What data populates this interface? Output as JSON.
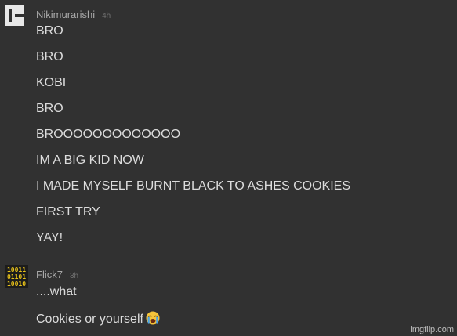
{
  "comments": [
    {
      "username": "Nikimurarishi",
      "time": "4h",
      "avatar_icon": "imgflip-e-logo-icon",
      "lines": [
        "BRO",
        "BRO",
        "KOBI",
        "BRO",
        "BROOOOOOOOOOOOO",
        "IM A BIG KID NOW",
        "I MADE MYSELF BURNT BLACK TO ASHES COOKIES",
        "FIRST TRY",
        "YAY!"
      ]
    },
    {
      "username": "Flick7",
      "time": "3h",
      "avatar_icon": "binary-digits-avatar-icon",
      "lines": [
        "....what",
        "Cookies or yourself"
      ],
      "emoji": "loudly-crying-face-icon"
    }
  ],
  "watermark": "imgflip.com",
  "colors": {
    "background": "#313131",
    "username": "#a9a9a9",
    "text": "#dcdcdc",
    "binary_avatar": "#e8c21a"
  }
}
